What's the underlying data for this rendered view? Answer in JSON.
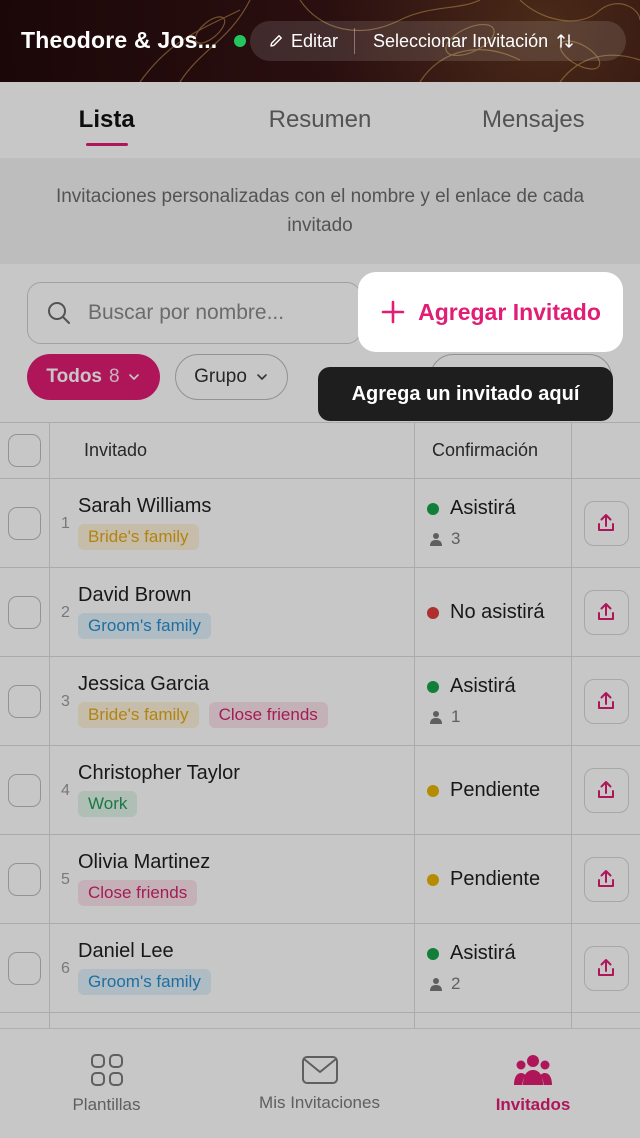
{
  "header": {
    "title": "Theodore & Jos...",
    "edit_label": "Editar",
    "select_label": "Seleccionar Invitación"
  },
  "tabs": [
    {
      "label": "Lista",
      "active": true
    },
    {
      "label": "Resumen",
      "active": false
    },
    {
      "label": "Mensajes",
      "active": false
    }
  ],
  "description": "Invitaciones personalizadas con el nombre y el enlace de cada invitado",
  "search": {
    "placeholder": "Buscar por nombre..."
  },
  "add_button": {
    "label": "Agregar Invitado"
  },
  "tooltip": "Agrega un invitado aquí",
  "filters": {
    "all_label": "Todos",
    "all_count": "8",
    "group_label": "Grupo"
  },
  "table": {
    "headers": {
      "guest": "Invitado",
      "confirmation": "Confirmación"
    },
    "rows": [
      {
        "index": "1",
        "name": "Sarah Williams",
        "tags": [
          {
            "label": "Bride's family",
            "type": "bride"
          }
        ],
        "status": "Asistirá",
        "status_color": "#16a34a",
        "count": "3"
      },
      {
        "index": "2",
        "name": "David Brown",
        "tags": [
          {
            "label": "Groom's family",
            "type": "groom"
          }
        ],
        "status": "No asistirá",
        "status_color": "#e03c3c",
        "count": ""
      },
      {
        "index": "3",
        "name": "Jessica Garcia",
        "tags": [
          {
            "label": "Bride's family",
            "type": "bride"
          },
          {
            "label": "Close friends",
            "type": "friends"
          }
        ],
        "status": "Asistirá",
        "status_color": "#16a34a",
        "count": "1"
      },
      {
        "index": "4",
        "name": "Christopher Taylor",
        "tags": [
          {
            "label": "Work",
            "type": "work"
          }
        ],
        "status": "Pendiente",
        "status_color": "#e8b400",
        "count": ""
      },
      {
        "index": "5",
        "name": "Olivia Martinez",
        "tags": [
          {
            "label": "Close friends",
            "type": "friends"
          }
        ],
        "status": "Pendiente",
        "status_color": "#e8b400",
        "count": ""
      },
      {
        "index": "6",
        "name": "Daniel Lee",
        "tags": [
          {
            "label": "Groom's family",
            "type": "groom"
          }
        ],
        "status": "Asistirá",
        "status_color": "#16a34a",
        "count": "2"
      }
    ]
  },
  "bottom_nav": [
    {
      "label": "Plantillas",
      "icon": "grid-icon",
      "active": false
    },
    {
      "label": "Mis Invitaciones",
      "icon": "envelope-icon",
      "active": false
    },
    {
      "label": "Invitados",
      "icon": "people-icon",
      "active": true
    }
  ],
  "colors": {
    "accent": "#e11d74",
    "online": "#22c55e"
  }
}
